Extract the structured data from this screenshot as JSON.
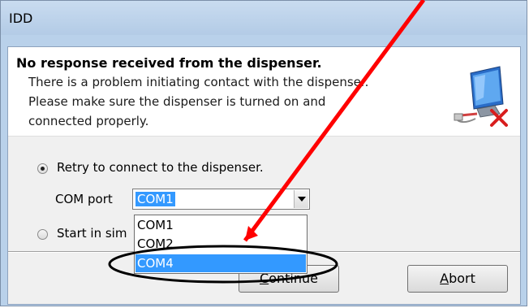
{
  "window": {
    "title": "IDD"
  },
  "message": {
    "title": "No response received from the dispenser.",
    "lines": [
      "There is a problem initiating contact with the dispenser.",
      "Please make sure the dispenser is turned on and",
      "connected properly."
    ]
  },
  "options": {
    "retry_label": "Retry to connect to the dispenser.",
    "com_port_label": "COM port",
    "com_port_value": "COM1",
    "simulation_label_visible": "Start in sim"
  },
  "dropdown": {
    "items": [
      "COM1",
      "COM2",
      "COM4"
    ],
    "selected": "COM4"
  },
  "buttons": {
    "continue_prefix": "",
    "continue_accel": "C",
    "continue_rest": "ontinue",
    "abort_accel": "A",
    "abort_rest": "bort"
  },
  "colors": {
    "selection": "#3399ff",
    "annotation_arrow": "#ff0000",
    "annotation_ellipse": "#000000"
  },
  "icons": {
    "dialog_icon": "computer-disconnected-icon",
    "dropdown_arrow": "chevron-down-icon"
  }
}
